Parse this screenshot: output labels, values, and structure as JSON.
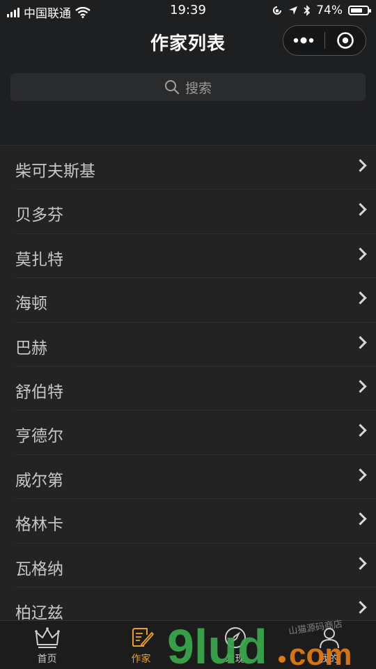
{
  "status_bar": {
    "carrier": "中国联通",
    "time": "19:39",
    "battery_percent": "74%",
    "battery_level": 0.74
  },
  "navbar": {
    "title": "作家列表"
  },
  "search": {
    "placeholder": "搜索"
  },
  "composers": [
    {
      "name": "柴可夫斯基"
    },
    {
      "name": "贝多芬"
    },
    {
      "name": "莫扎特"
    },
    {
      "name": "海顿"
    },
    {
      "name": "巴赫"
    },
    {
      "name": "舒伯特"
    },
    {
      "name": "亨德尔"
    },
    {
      "name": "威尔第"
    },
    {
      "name": "格林卡"
    },
    {
      "name": "瓦格纳"
    },
    {
      "name": "柏辽兹"
    }
  ],
  "tabbar": {
    "tabs": [
      {
        "label": "首页",
        "icon": "crown-icon"
      },
      {
        "label": "作家",
        "icon": "quill-paper-icon",
        "active": true
      },
      {
        "label": "发现",
        "icon": "compass-icon"
      },
      {
        "label": "我的",
        "icon": "person-icon"
      }
    ]
  },
  "watermark": {
    "text": "9lud.com",
    "subtext": "山猫源码商店",
    "colors": {
      "nine": "#3aa84a",
      "dot_com": "#e07a10"
    }
  },
  "colors": {
    "accent": "#f0a020",
    "background": "#232323",
    "header": "#1e1f21"
  }
}
